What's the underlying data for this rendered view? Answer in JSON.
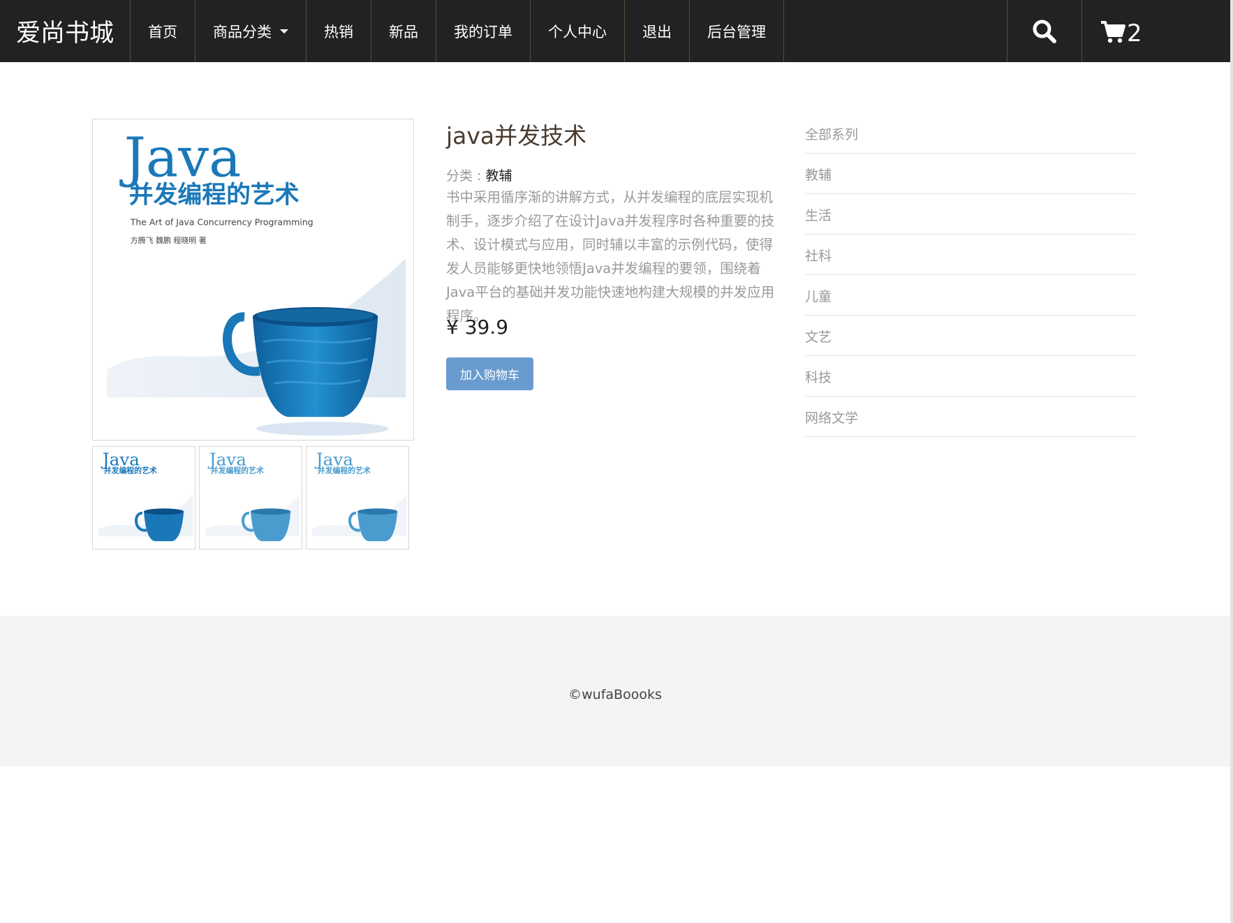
{
  "navbar": {
    "brand": "爱尚书城",
    "items": [
      {
        "label": "首页"
      },
      {
        "label": "商品分类",
        "dropdown": true
      },
      {
        "label": "热销"
      },
      {
        "label": "新品"
      },
      {
        "label": "我的订单"
      },
      {
        "label": "个人中心"
      },
      {
        "label": "退出"
      },
      {
        "label": "后台管理"
      }
    ],
    "search_icon": "search-icon",
    "cart_icon": "cart-icon",
    "cart_count": "2"
  },
  "product": {
    "title": "java并发技术",
    "category_label": "分类 : ",
    "category_value": "教辅",
    "description": "书中采用循序渐的讲解方式，从并发编程的底层实现机制手，逐步介绍了在设计Java并发程序时各种重要的技术、设计模式与应用，同时辅以丰富的示例代码，使得发人员能够更快地领悟Java并发编程的要领，围绕着Java平台的基础并发功能快速地构建大规模的并发应用程序。",
    "price": "¥ 39.9",
    "add_to_cart": "加入购物车",
    "cover": {
      "title_en": "Java",
      "title_cn": "并发编程的艺术",
      "subtitle": "The Art of Java Concurrency Programming",
      "authors": "方腾飞 魏鹏 程晓明 著"
    }
  },
  "categories": [
    "全部系列",
    "教辅",
    "生活",
    "社科",
    "儿童",
    "文艺",
    "科技",
    "网络文学"
  ],
  "footer": {
    "text": "©wufaBoooks"
  },
  "colors": {
    "navbar_bg": "#222222",
    "button_bg": "#6a9bd0",
    "cup_blue": "#1a78b8",
    "footer_bg": "#f2f4f5"
  }
}
